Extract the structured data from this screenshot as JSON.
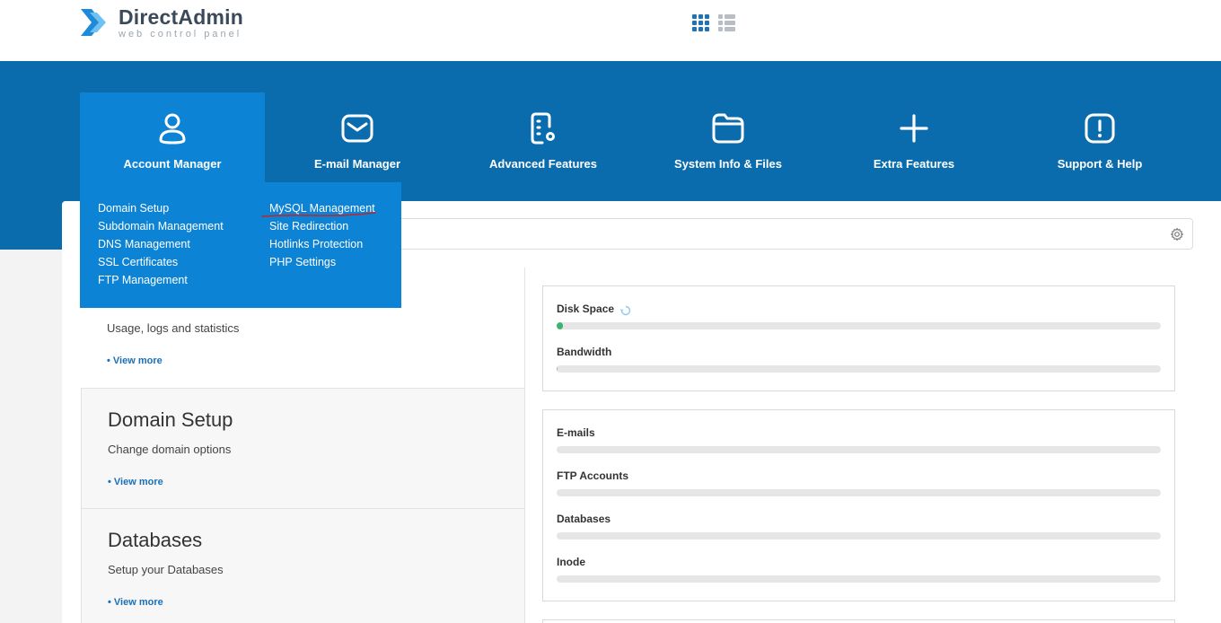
{
  "brand": {
    "title": "DirectAdmin",
    "subtitle": "web control panel"
  },
  "view_toggle": {
    "grid_icon": "grid-view-icon",
    "list_icon": "list-view-icon"
  },
  "nav": [
    {
      "label": "Account Manager",
      "icon": "user-icon",
      "active": true
    },
    {
      "label": "E-mail Manager",
      "icon": "envelope-icon"
    },
    {
      "label": "Advanced Features",
      "icon": "document-gear-icon"
    },
    {
      "label": "System Info & Files",
      "icon": "folder-icon"
    },
    {
      "label": "Extra Features",
      "icon": "plus-icon"
    },
    {
      "label": "Support & Help",
      "icon": "alert-icon"
    }
  ],
  "dropdown": {
    "col1": [
      "Domain Setup",
      "Subdomain Management",
      "DNS Management",
      "SSL Certificates",
      "FTP Management"
    ],
    "col2": [
      "MySQL Management",
      "Site Redirection",
      "Hotlinks Protection",
      "PHP Settings"
    ]
  },
  "cards": [
    {
      "title": "",
      "desc": "Usage, logs and statistics",
      "link": "• View more"
    },
    {
      "title": "Domain Setup",
      "desc": "Change domain options",
      "link": "• View more"
    },
    {
      "title": "Databases",
      "desc": "Setup your Databases",
      "link": "• View more"
    }
  ],
  "stats_usage": [
    {
      "label": "Disk Space",
      "fill": 0.01
    },
    {
      "label": "Bandwidth",
      "fill": 0.002
    }
  ],
  "stats_counts": [
    {
      "label": "E-mails",
      "fill": 0
    },
    {
      "label": "FTP Accounts",
      "fill": 0
    },
    {
      "label": "Databases",
      "fill": 0
    },
    {
      "label": "Inode",
      "fill": 0
    }
  ],
  "colors": {
    "band": "#0b6cad",
    "active_tile": "#0c83d4",
    "link": "#1a70b8",
    "bar_fill": "#3cb46e"
  }
}
